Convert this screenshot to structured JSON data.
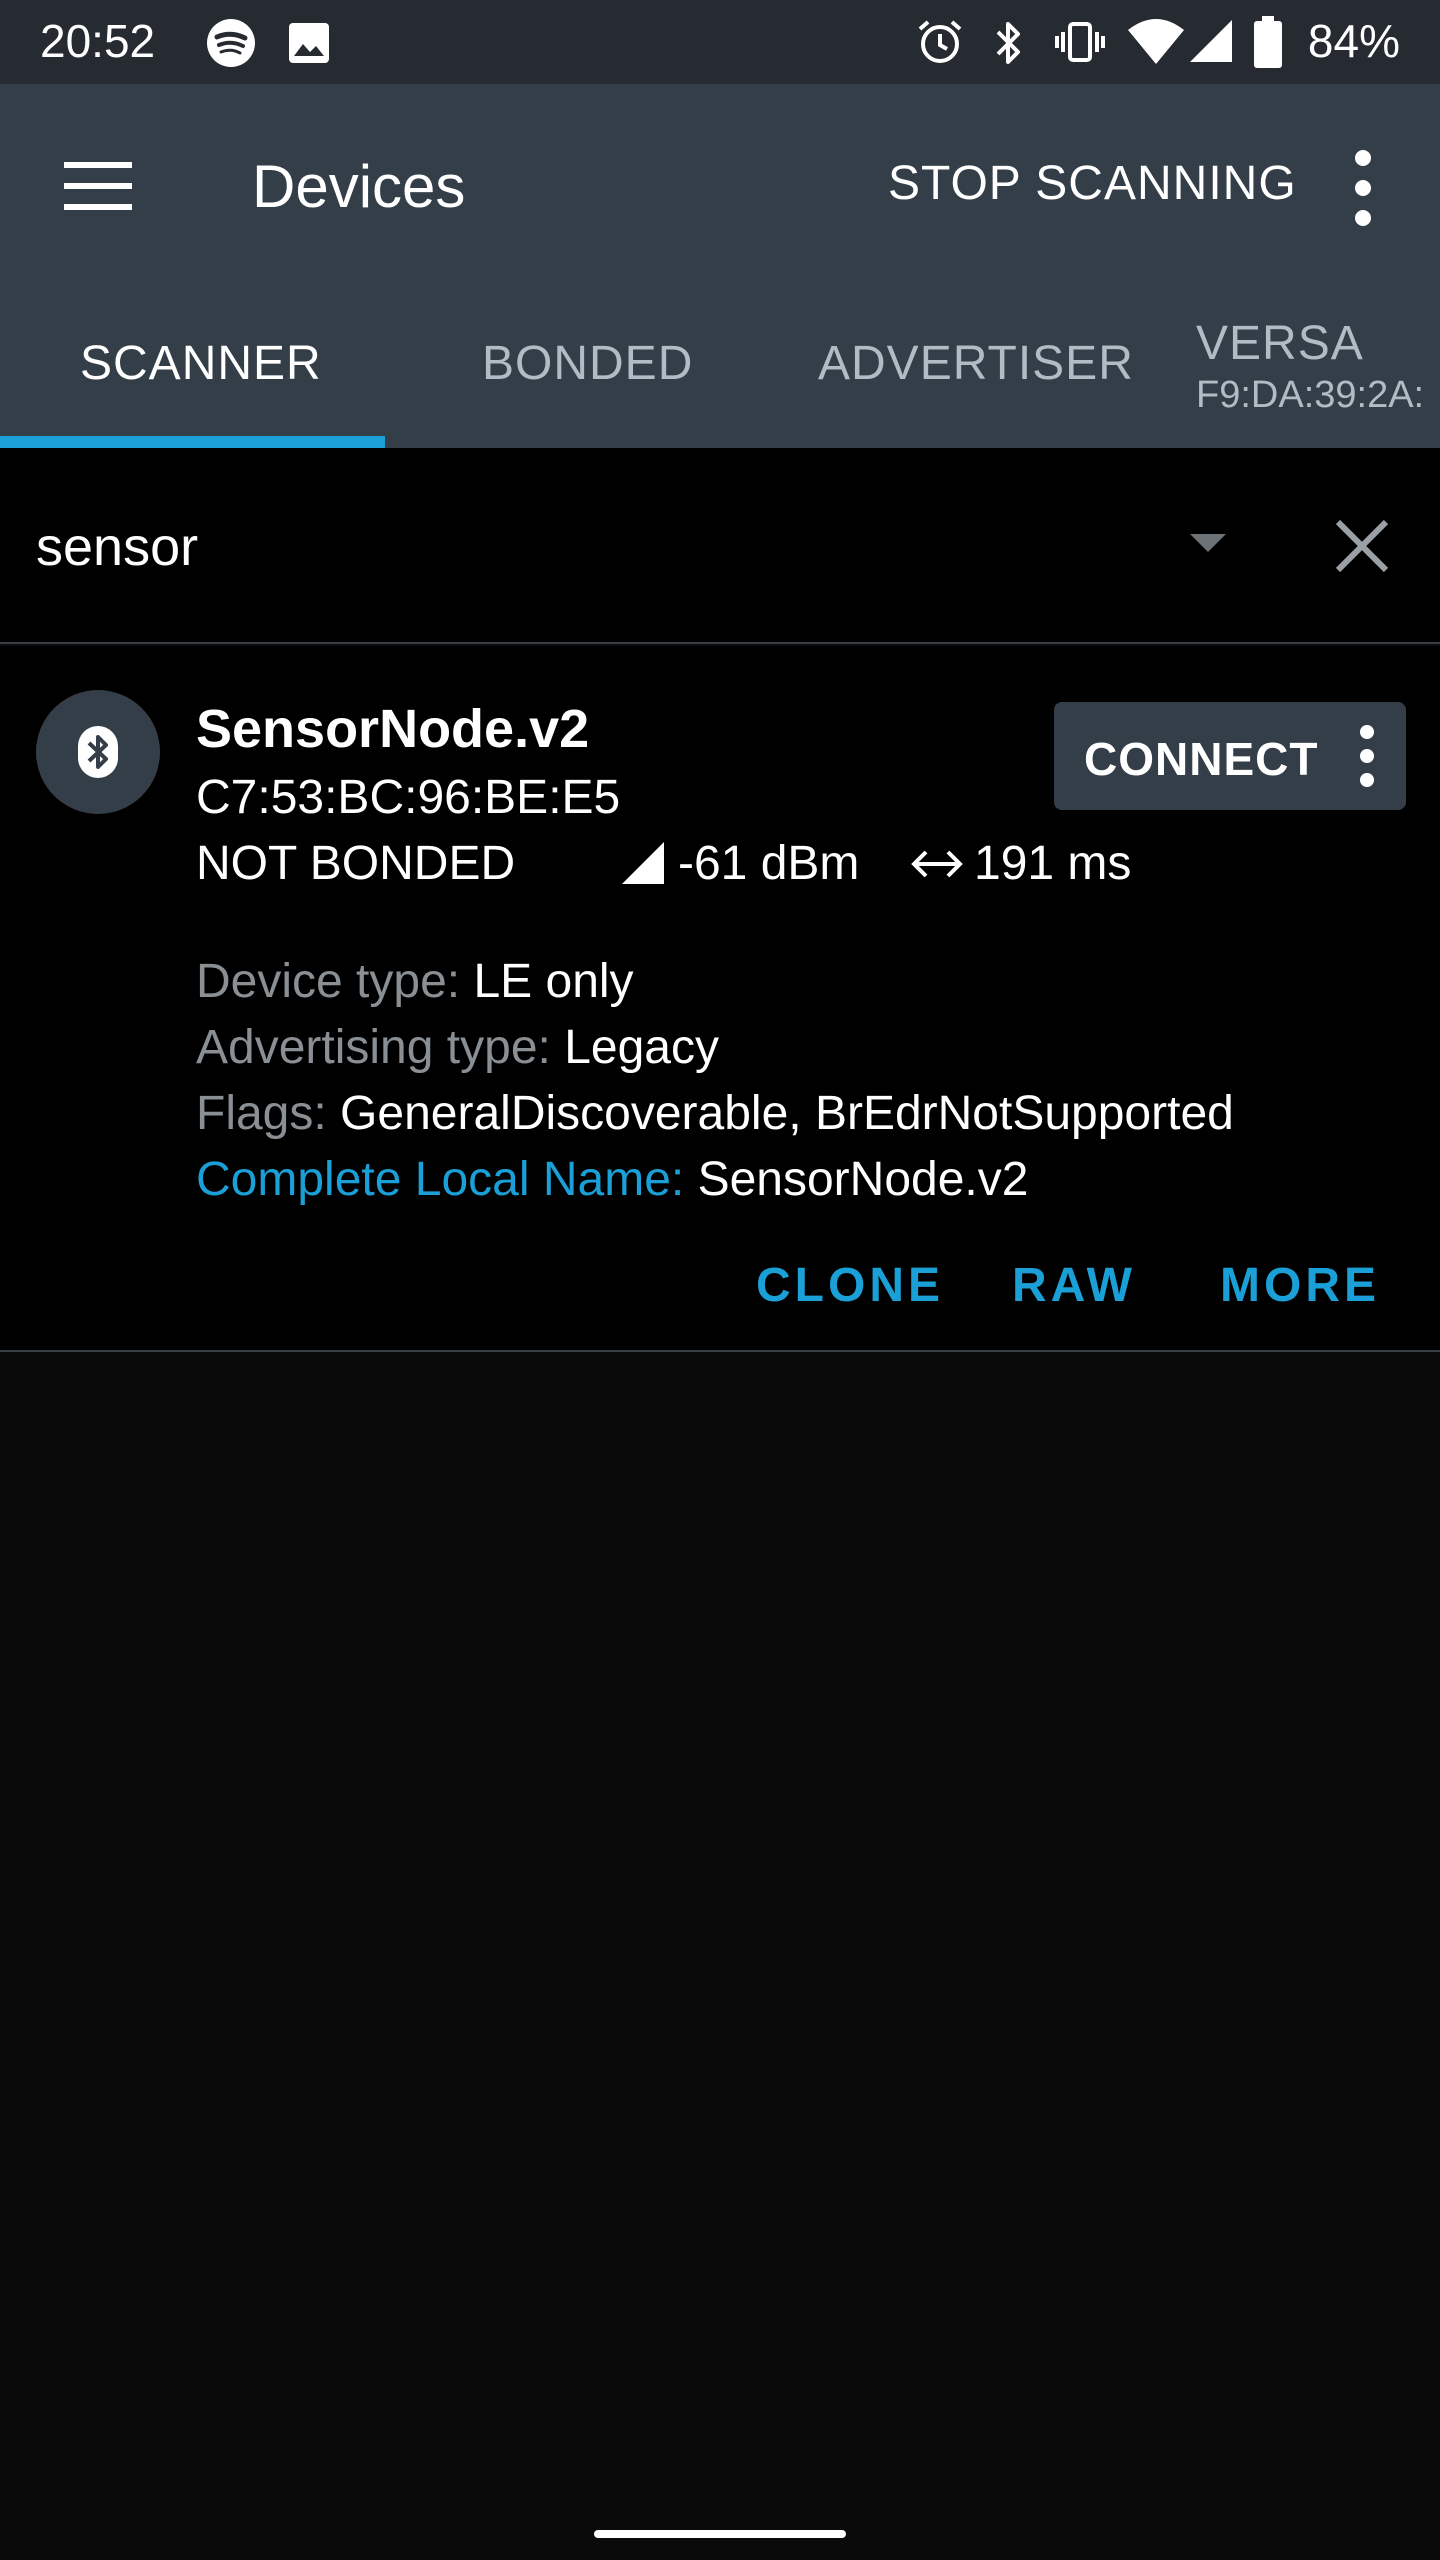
{
  "status_bar": {
    "time": "20:52",
    "battery": "84%",
    "left_icons": [
      "spotify-icon",
      "image-icon"
    ],
    "right_icons": [
      "alarm-icon",
      "bluetooth-icon",
      "vibrate-icon",
      "wifi-icon",
      "signal-icon",
      "battery-icon"
    ]
  },
  "app_bar": {
    "title": "Devices",
    "stop_scanning": "STOP SCANNING",
    "bg_color": "#343e48"
  },
  "tabs": [
    {
      "label": "SCANNER",
      "active": true
    },
    {
      "label": "BONDED",
      "active": false
    },
    {
      "label": "ADVERTISER",
      "active": false
    },
    {
      "label": "VERSA",
      "sub": "F9:DA:39:2A:",
      "active": false
    }
  ],
  "accent_color": "#1a9fd6",
  "search": {
    "value": "sensor"
  },
  "device": {
    "name": "SensorNode.v2",
    "address": "C7:53:BC:96:BE:E5",
    "bond_state": "NOT BONDED",
    "rssi": "-61 dBm",
    "interval": "191 ms",
    "connect_label": "CONNECT",
    "details": [
      {
        "key": "Device type: ",
        "value": "LE only"
      },
      {
        "key": "Advertising type: ",
        "value": "Legacy"
      },
      {
        "key": "Flags: ",
        "value": "GeneralDiscoverable, BrEdrNotSupported"
      },
      {
        "key": "Complete Local Name: ",
        "value": "SensorNode.v2"
      }
    ],
    "actions": {
      "clone": "CLONE",
      "raw": "RAW",
      "more": "MORE"
    }
  }
}
